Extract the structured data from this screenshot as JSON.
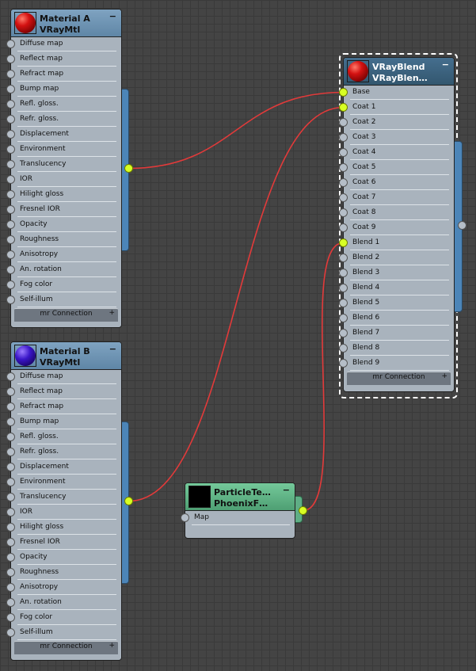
{
  "nodes": {
    "material_a": {
      "title": "Material A",
      "subtitle": "VRayMtl",
      "collapse": "−",
      "slots": [
        "Diffuse map",
        "Reflect map",
        "Refract map",
        "Bump map",
        "Refl. gloss.",
        "Refr. gloss.",
        "Displacement",
        "Environment",
        "Translucency",
        "IOR",
        "Hilight gloss",
        "Fresnel IOR",
        "Opacity",
        "Roughness",
        "Anisotropy",
        "An. rotation",
        "Fog color",
        "Self-illum"
      ],
      "footer": "mr Connection",
      "footer_plus": "+"
    },
    "material_b": {
      "title": "Material B",
      "subtitle": "VRayMtl",
      "collapse": "−",
      "slots": [
        "Diffuse map",
        "Reflect map",
        "Refract map",
        "Bump map",
        "Refl. gloss.",
        "Refr. gloss.",
        "Displacement",
        "Environment",
        "Translucency",
        "IOR",
        "Hilight gloss",
        "Fresnel IOR",
        "Opacity",
        "Roughness",
        "Anisotropy",
        "An. rotation",
        "Fog color",
        "Self-illum"
      ],
      "footer": "mr Connection",
      "footer_plus": "+"
    },
    "vrayblend": {
      "title": "VRayBlend",
      "subtitle": "VRayBlen…",
      "collapse": "−",
      "slots": [
        "Base",
        "Coat 1",
        "Coat 2",
        "Coat 3",
        "Coat 4",
        "Coat 5",
        "Coat 6",
        "Coat 7",
        "Coat 8",
        "Coat 9",
        "Blend 1",
        "Blend 2",
        "Blend 3",
        "Blend 4",
        "Blend 5",
        "Blend 6",
        "Blend 7",
        "Blend 8",
        "Blend 9"
      ],
      "connected_slots": [
        "Base",
        "Coat 1",
        "Blend 1"
      ],
      "footer": "mr Connection",
      "footer_plus": "+"
    },
    "particle": {
      "title": "ParticleTe…",
      "subtitle": "PhoenixF…",
      "collapse": "−",
      "slots": [
        "Map"
      ]
    }
  },
  "colors": {
    "wire": "#e23a3a",
    "connected_socket": "#d8ff24",
    "canvas": "#444444"
  }
}
